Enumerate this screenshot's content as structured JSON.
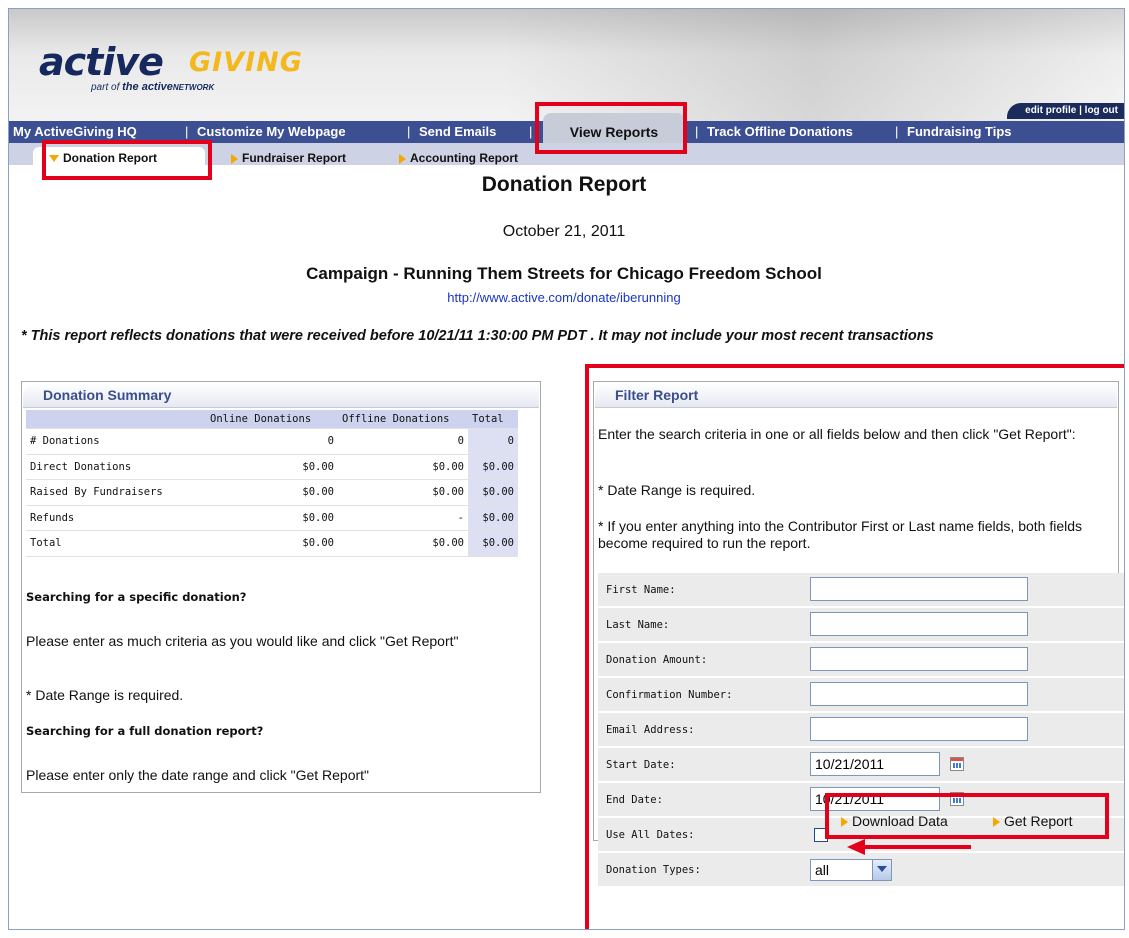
{
  "logo": {
    "active": "active",
    "giving": "GIVING",
    "sub_prefix": "part of",
    "sub_brand": "the active",
    "sub_network": "NETWORK"
  },
  "account": {
    "edit_profile": "edit profile",
    "separator": "|",
    "log_out": "log out"
  },
  "nav": {
    "items": [
      "My ActiveGiving HQ",
      "Customize My Webpage",
      "Send Emails",
      "View Reports",
      "Track Offline Donations",
      "Fundraising Tips"
    ],
    "separator": "|"
  },
  "subnav": {
    "items": [
      "Donation Report",
      "Fundraiser Report",
      "Accounting Report"
    ]
  },
  "report": {
    "title": "Donation Report",
    "date": "October 21, 2011",
    "campaign": "Campaign - Running Them Streets for Chicago Freedom School",
    "url": "http://www.active.com/donate/iberunning",
    "notice": "* This report reflects donations that were received before 10/21/11 1:30:00 PM PDT . It may not include your most recent transactions"
  },
  "summary": {
    "title": "Donation Summary",
    "columns": [
      "",
      "Online Donations",
      "Offline Donations",
      "Total"
    ],
    "rows": [
      [
        "# Donations",
        "0",
        "0",
        "0"
      ],
      [
        "Direct Donations",
        "$0.00",
        "$0.00",
        "$0.00"
      ],
      [
        "Raised By Fundraisers",
        "$0.00",
        "$0.00",
        "$0.00"
      ],
      [
        "Refunds",
        "$0.00",
        "-",
        "$0.00"
      ],
      [
        "Total",
        "$0.00",
        "$0.00",
        "$0.00"
      ]
    ],
    "specific_heading": "Searching for a specific donation?",
    "specific_text": "Please enter as much criteria as you would like and click \"Get Report\"",
    "date_required": "* Date Range is required.",
    "full_heading": "Searching for a full donation report?",
    "full_text": "Please enter only the date range and click \"Get Report\""
  },
  "filter": {
    "title": "Filter Report",
    "intro": "Enter the search criteria in one or all fields below and then click \"Get Report\":",
    "date_required": "* Date Range is required.",
    "name_note": "* If you enter anything into the Contributor First or Last name fields, both fields become required to run the report.",
    "labels": {
      "first_name": "First Name:",
      "last_name": "Last Name:",
      "amount": "Donation Amount:",
      "confirmation": "Confirmation Number:",
      "email": "Email Address:",
      "start_date": "Start Date:",
      "end_date": "End Date:",
      "use_all_dates": "Use All Dates:",
      "donation_types": "Donation Types:"
    },
    "values": {
      "first_name": "",
      "last_name": "",
      "amount": "",
      "confirmation": "",
      "email": "",
      "start_date": "10/21/2011",
      "end_date": "10/21/2011",
      "use_all_dates": false,
      "donation_types": "all"
    },
    "download_label": "Download Data",
    "get_report_label": "Get Report"
  },
  "colors": {
    "nav_bar": "#3d4f93",
    "highlight": "#e2001a",
    "accent_arrow": "#f5a800",
    "link": "#1a35c7"
  }
}
